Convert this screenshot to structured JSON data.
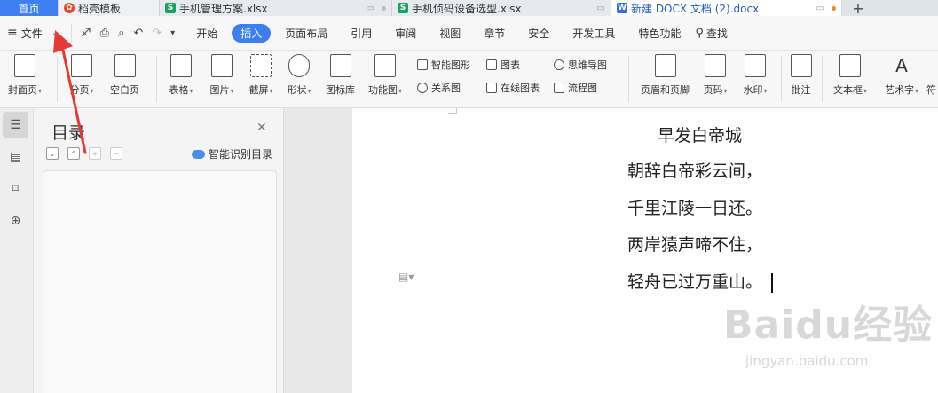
{
  "tabs": [
    {
      "label": "首页",
      "kind": "home"
    },
    {
      "label": "稻壳模板",
      "kind": "daoke",
      "icon": "daoke-icon"
    },
    {
      "label": "手机管理方案.xlsx",
      "kind": "sheet",
      "icon": "sheet-icon"
    },
    {
      "label": "手机侦码设备选型.xlsx",
      "kind": "sheet",
      "icon": "sheet-icon"
    },
    {
      "label": "新建 DOCX 文档 (2).docx",
      "kind": "doc",
      "icon": "doc-icon"
    }
  ],
  "add_tab": "+",
  "menu": {
    "file": "文件",
    "items": [
      "开始",
      "插入",
      "页面布局",
      "引用",
      "审阅",
      "视图",
      "章节",
      "安全",
      "开发工具",
      "特色功能"
    ],
    "active": "插入",
    "search": "查找"
  },
  "ribbon": {
    "large": [
      "封面页",
      "分页",
      "空白页",
      "表格",
      "图片",
      "截屏",
      "形状",
      "图标库",
      "功能图",
      "页眉和页脚",
      "页码",
      "水印",
      "批注",
      "文本框",
      "艺术字",
      "符"
    ],
    "small": [
      "智能图形",
      "图表",
      "思维导图",
      "关系图",
      "在线图表",
      "流程图"
    ]
  },
  "toc": {
    "title": "目录",
    "smart_label": "智能识别目录"
  },
  "document": {
    "title": "早发白帝城",
    "lines": [
      "朝辞白帝彩云间，",
      "千里江陵一日还。",
      "两岸猿声啼不住，",
      "轻舟已过万重山。"
    ]
  },
  "watermark": {
    "brand": "Baidu经验",
    "url": "jingyan.baidu.com"
  },
  "colors": {
    "accent": "#3d7ef0",
    "annotation_arrow": "#e53935"
  }
}
